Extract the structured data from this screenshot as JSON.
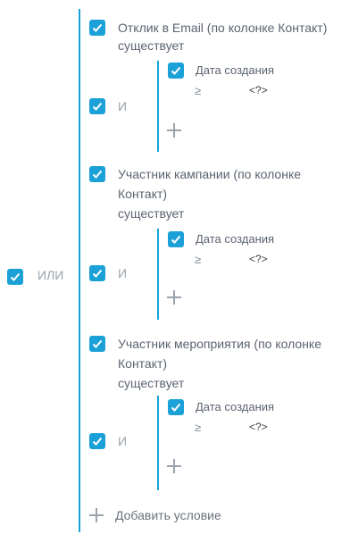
{
  "root": {
    "operator": "ИЛИ"
  },
  "groups": [
    {
      "title_line1": "Отклик в Email (по колонке Контакт)",
      "title_line2": "",
      "status": "существует",
      "operator": "И",
      "condition": {
        "field": "Дата создания",
        "op": "≥",
        "value": "<?>"
      }
    },
    {
      "title_line1": "Участник кампании (по колонке",
      "title_line2": "Контакт)",
      "status": "существует",
      "operator": "И",
      "condition": {
        "field": "Дата создания",
        "op": "≥",
        "value": "<?>"
      }
    },
    {
      "title_line1": "Участник мероприятия (по колонке",
      "title_line2": "Контакт)",
      "status": "существует",
      "operator": "И",
      "condition": {
        "field": "Дата создания",
        "op": "≥",
        "value": "<?>"
      }
    }
  ],
  "add_condition_label": "Добавить условие",
  "colors": {
    "accent": "#1ba1d8",
    "muted": "#9aa3ad"
  }
}
